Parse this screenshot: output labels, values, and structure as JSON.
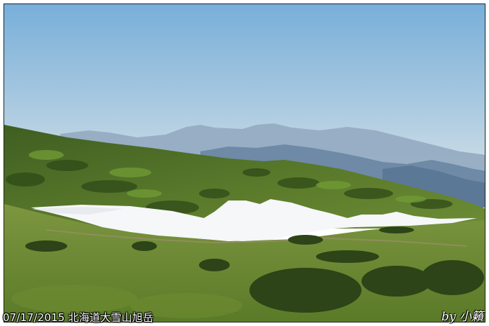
{
  "photo": {
    "subject": "mountain-landscape",
    "colors": {
      "sky_top": "#7fb4dc",
      "sky_bottom": "#cfe0ea",
      "far_mountains": "#8ea7bf",
      "mid_mountains": "#6e8ba8",
      "forest_dark": "#3d5a22",
      "forest_light": "#5e7f2e",
      "meadow": "#6f8a35",
      "snow": "#f7f8fa"
    }
  },
  "overlay": {
    "date_caption": "07/17/2015 北海道大雪山旭岳",
    "credit": "by 小籟"
  }
}
